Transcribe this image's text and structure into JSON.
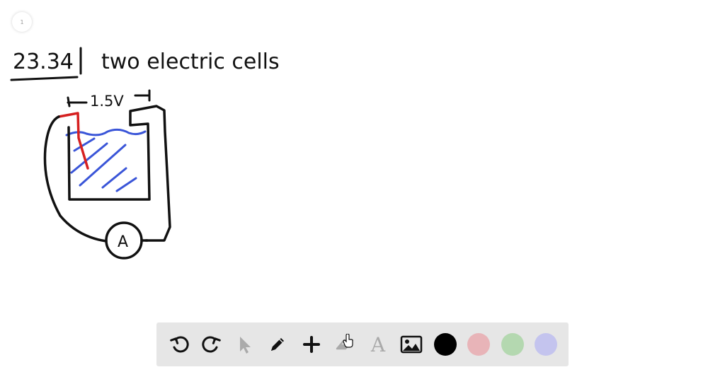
{
  "page": {
    "number": "1"
  },
  "notes": {
    "problem_number": "23.34",
    "title": "two electric cells",
    "voltage_label": "1.5V",
    "ammeter_label": "A"
  },
  "colors": {
    "ink": "#111111",
    "electrode_red": "#d62020",
    "electrolyte_blue": "#3a55d8",
    "toolbar_bg": "#e6e6e6"
  },
  "toolbar": {
    "tools": [
      {
        "name": "undo-icon",
        "enabled": true
      },
      {
        "name": "redo-icon",
        "enabled": true
      },
      {
        "name": "pointer-icon",
        "enabled": false
      },
      {
        "name": "pencil-icon",
        "enabled": true
      },
      {
        "name": "plus-icon",
        "enabled": true
      },
      {
        "name": "eraser-icon",
        "enabled": false
      },
      {
        "name": "text-icon",
        "enabled": false,
        "glyph": "A"
      },
      {
        "name": "image-icon",
        "enabled": true
      }
    ],
    "swatches": [
      {
        "name": "black",
        "color": "#000000"
      },
      {
        "name": "pink",
        "color": "#e8b4b8"
      },
      {
        "name": "green",
        "color": "#b4d8b0"
      },
      {
        "name": "lavender",
        "color": "#c4c4ee"
      }
    ]
  }
}
